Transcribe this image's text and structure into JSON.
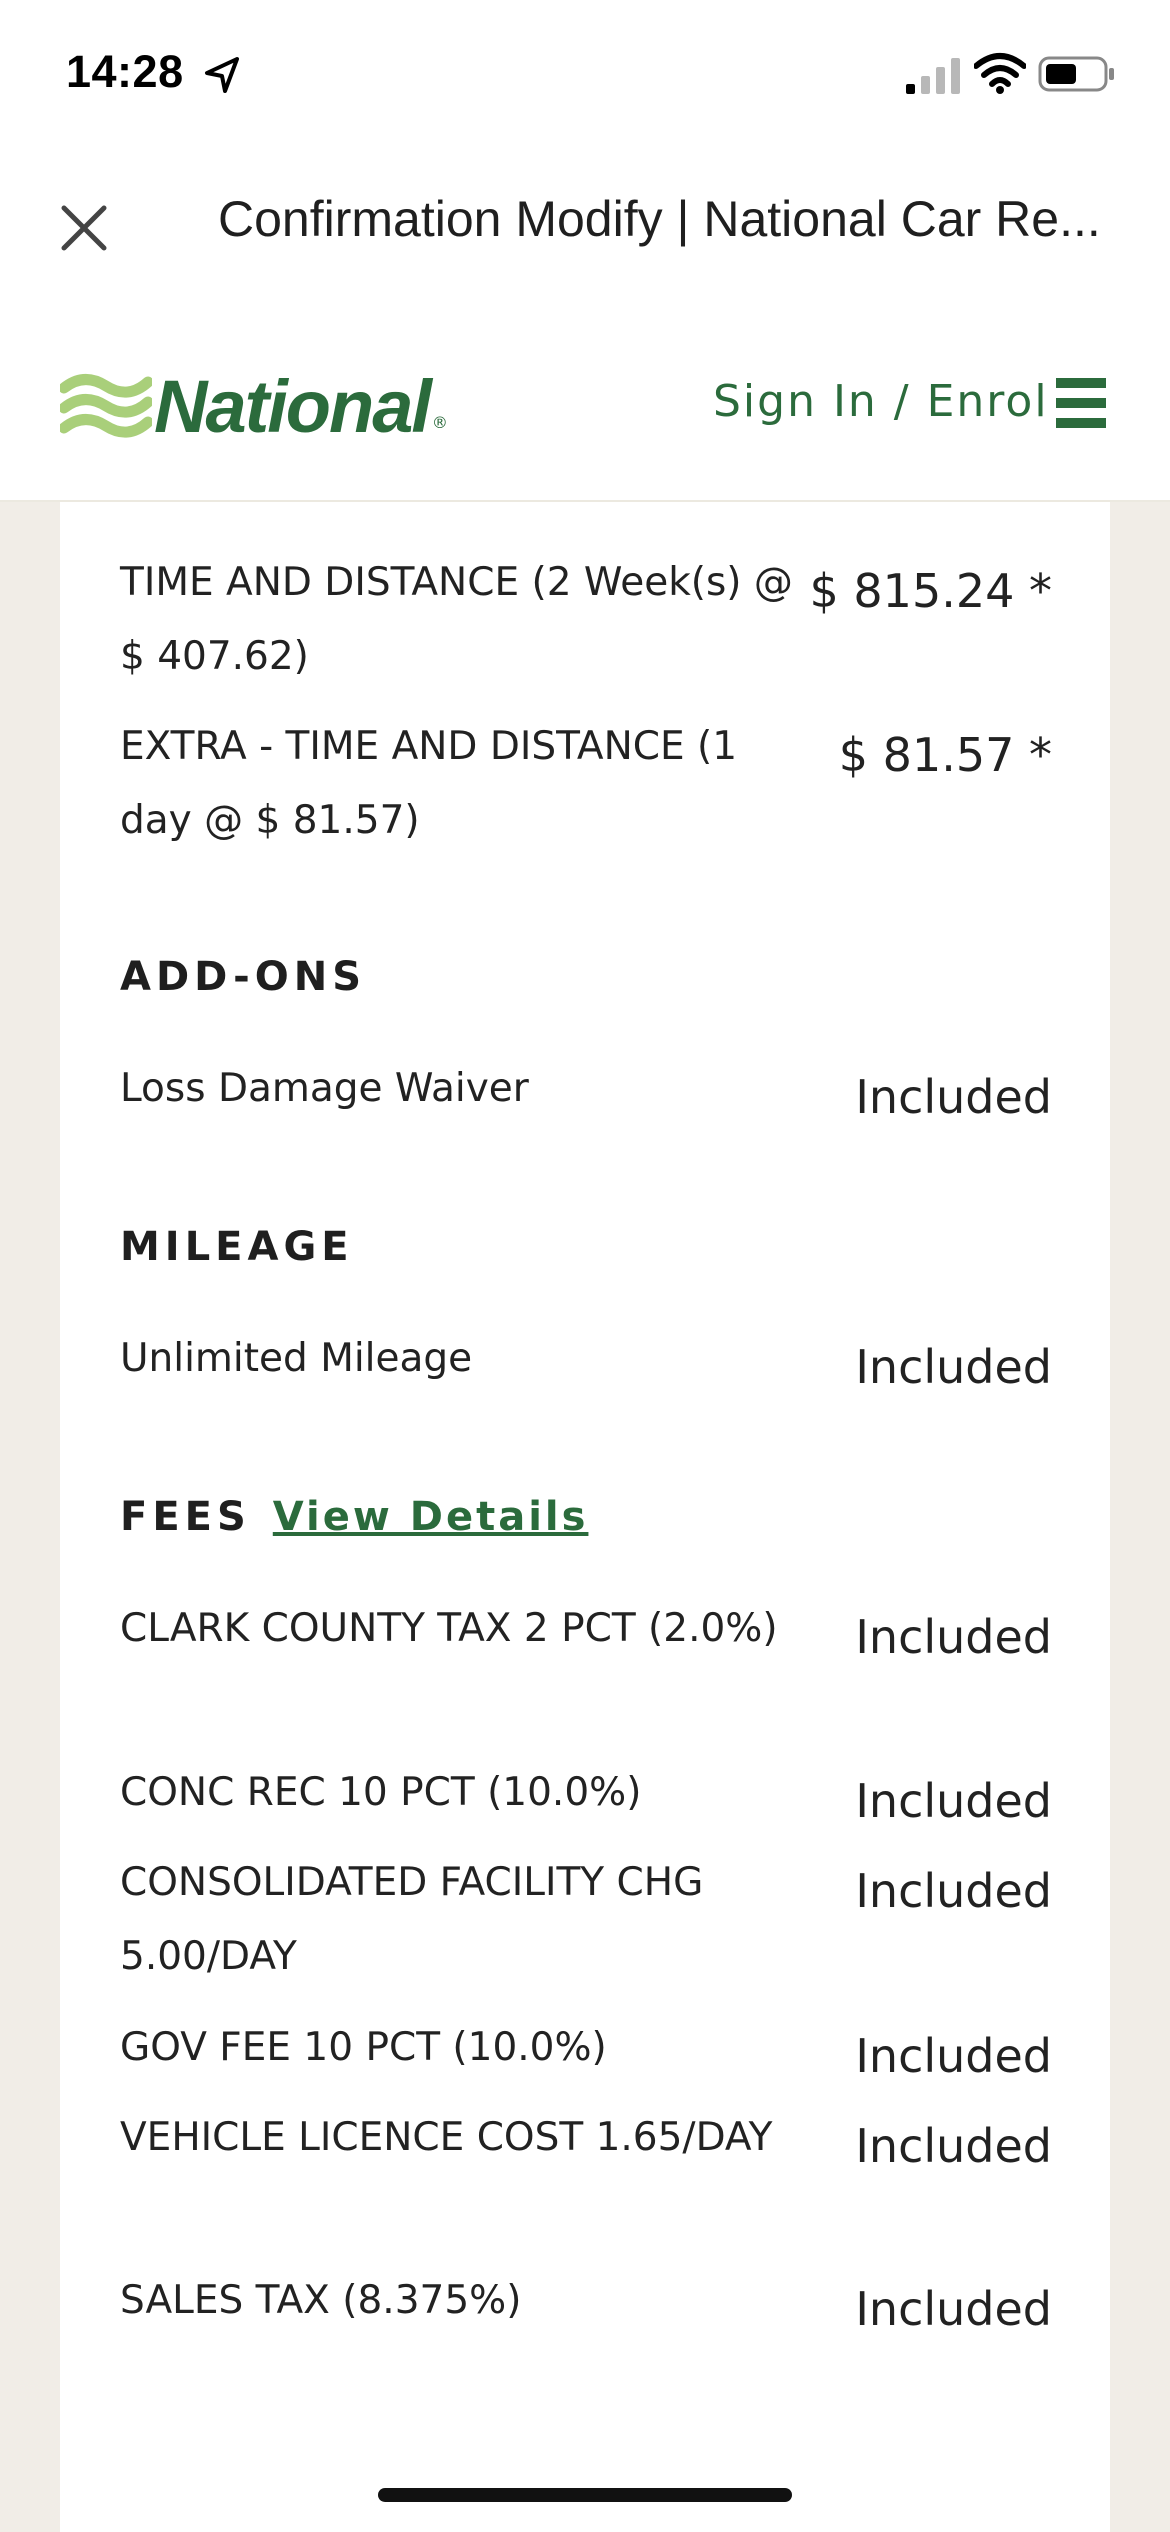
{
  "status_bar": {
    "time": "14:28"
  },
  "browser": {
    "title": "Confirmation Modify | National Car Re..."
  },
  "header": {
    "logo_text": "National",
    "signin": "Sign In / Enrol"
  },
  "charges": [
    {
      "label": "TIME AND DISTANCE (2 Week(s) @ $ 407.62)",
      "value": "$ 815.24 *"
    },
    {
      "label": "EXTRA - TIME AND DISTANCE (1 day @ $ 81.57)",
      "value": "$ 81.57 *"
    }
  ],
  "addons": {
    "title": "ADD-ONS",
    "items": [
      {
        "label": "Loss Damage Waiver",
        "value": "Included"
      }
    ]
  },
  "mileage": {
    "title": "MILEAGE",
    "items": [
      {
        "label": "Unlimited Mileage",
        "value": "Included"
      }
    ]
  },
  "fees": {
    "title": "FEES",
    "link": "View Details",
    "items": [
      {
        "label": "CLARK COUNTY TAX 2 PCT (2.0%)",
        "value": "Included"
      },
      {
        "label": "CONC REC 10 PCT (10.0%)",
        "value": "Included"
      },
      {
        "label": "CONSOLIDATED FACILITY CHG 5.00/DAY",
        "value": "Included"
      },
      {
        "label": "GOV FEE 10 PCT (10.0%)",
        "value": "Included"
      },
      {
        "label": "VEHICLE LICENCE COST 1.65/DAY",
        "value": "Included"
      },
      {
        "label": "SALES TAX (8.375%)",
        "value": "Included"
      }
    ]
  },
  "colors": {
    "brand_green": "#2b6b3c",
    "logo_light_green": "#a9cf7a",
    "page_bg": "#f1ede7"
  }
}
